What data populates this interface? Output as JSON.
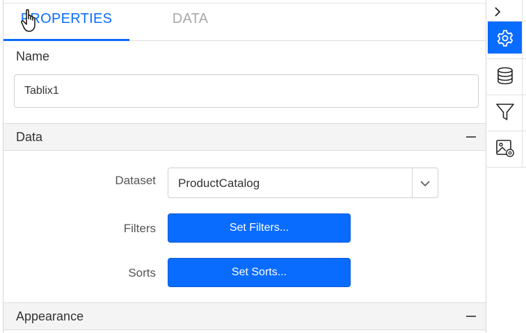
{
  "tabs": [
    {
      "label": "PROPERTIES",
      "active": true
    },
    {
      "label": "DATA",
      "active": false
    }
  ],
  "name": {
    "label": "Name",
    "value": "Tablix1"
  },
  "sections": {
    "data": {
      "title": "Data",
      "collapse_symbol": "minus"
    },
    "appearance": {
      "title": "Appearance",
      "collapse_symbol": "minus"
    }
  },
  "data_section": {
    "dataset_label": "Dataset",
    "dataset_value": "ProductCatalog",
    "filters_label": "Filters",
    "filters_button": "Set Filters...",
    "sorts_label": "Sorts",
    "sorts_button": "Set Sorts..."
  },
  "side_toolbar": {
    "items": [
      {
        "icon": "chevron-right-icon"
      },
      {
        "icon": "gear-icon",
        "active": true
      },
      {
        "icon": "database-icon"
      },
      {
        "icon": "filter-icon"
      },
      {
        "icon": "image-settings-icon"
      }
    ]
  },
  "colors": {
    "accent": "#0a6cff",
    "section_header_bg": "#f4f4f4",
    "inactive_tab": "#a8a8a8"
  }
}
